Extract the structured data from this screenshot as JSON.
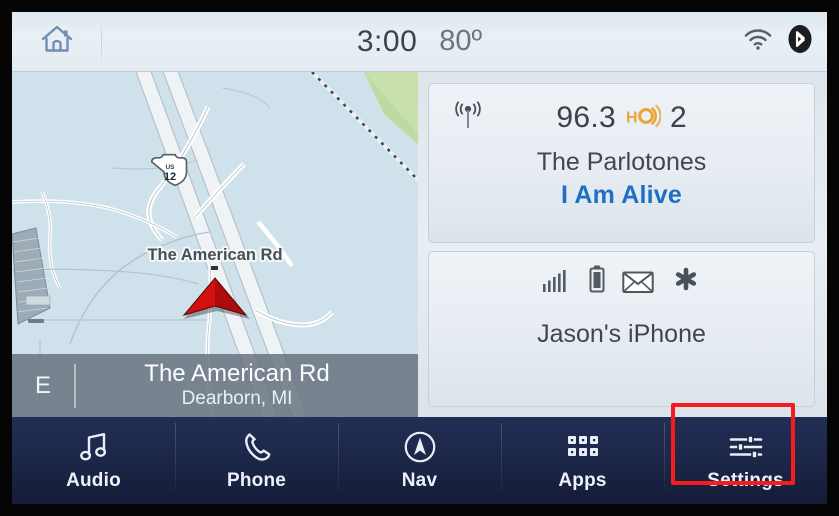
{
  "statusbar": {
    "home_icon": "home-icon",
    "time": "3:00",
    "temperature": "80º",
    "wifi_icon": "wifi-icon",
    "bluetooth_icon": "bluetooth-icon"
  },
  "map": {
    "highway_shield_prefix": "US",
    "highway_shield_number": "12",
    "road_label": "The American Rd",
    "vehicle_marker_icon": "vehicle-arrow-icon",
    "heading": "E",
    "street": "The American Rd",
    "city_state": "Dearborn, MI"
  },
  "radio": {
    "source_icon": "broadcast-tower-icon",
    "frequency": "96.3",
    "hd_logo": "hd-radio-icon",
    "hd_channel": "2",
    "artist": "The Parlotones",
    "song": "I Am Alive",
    "song_color": "#1f6fc4"
  },
  "phone": {
    "icons": [
      "signal-bars-icon",
      "battery-icon",
      "message-envelope-icon",
      "roaming-icon"
    ],
    "device_name": "Jason's iPhone"
  },
  "navbar": {
    "items": [
      {
        "label": "Audio",
        "icon": "music-note-icon"
      },
      {
        "label": "Phone",
        "icon": "phone-handset-icon"
      },
      {
        "label": "Nav",
        "icon": "compass-icon"
      },
      {
        "label": "Apps",
        "icon": "grid-apps-icon"
      },
      {
        "label": "Settings",
        "icon": "sliders-icon"
      }
    ],
    "highlighted_item": "Settings",
    "highlight_color": "#f41c1c"
  }
}
